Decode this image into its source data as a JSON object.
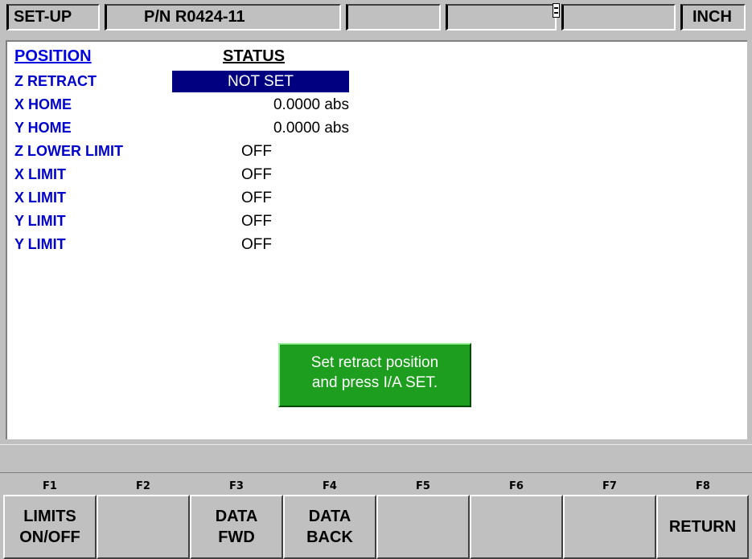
{
  "topbar": {
    "mode": "SET-UP",
    "part_number": "P/N R0424-11",
    "units": "INCH"
  },
  "table": {
    "headers": {
      "position": "POSITION",
      "status": "STATUS"
    },
    "rows": [
      {
        "label": "Z RETRACT",
        "status": "NOT SET",
        "selected": true
      },
      {
        "label": "X HOME",
        "status": "0.0000 abs"
      },
      {
        "label": "Y HOME",
        "status": "0.0000 abs"
      },
      {
        "label": "Z LOWER LIMIT",
        "status": "OFF"
      },
      {
        "label": "X LIMIT",
        "status": "OFF"
      },
      {
        "label": "X LIMIT",
        "status": "OFF"
      },
      {
        "label": "Y LIMIT",
        "status": "OFF"
      },
      {
        "label": "Y LIMIT",
        "status": "OFF"
      }
    ]
  },
  "message": {
    "line1": "Set retract position",
    "line2": "and press I/A SET."
  },
  "fkeys": [
    {
      "num": "F1",
      "line1": "LIMITS",
      "line2": "ON/OFF"
    },
    {
      "num": "F2",
      "line1": "",
      "line2": ""
    },
    {
      "num": "F3",
      "line1": "DATA",
      "line2": "FWD"
    },
    {
      "num": "F4",
      "line1": "DATA",
      "line2": "BACK"
    },
    {
      "num": "F5",
      "line1": "",
      "line2": ""
    },
    {
      "num": "F6",
      "line1": "",
      "line2": ""
    },
    {
      "num": "F7",
      "line1": "",
      "line2": ""
    },
    {
      "num": "F8",
      "line1": "RETURN",
      "line2": ""
    }
  ],
  "colors": {
    "background": "#c0c0c0",
    "label_blue": "#0000cc",
    "selection": "#000080",
    "message_green": "#1e9e1e"
  }
}
